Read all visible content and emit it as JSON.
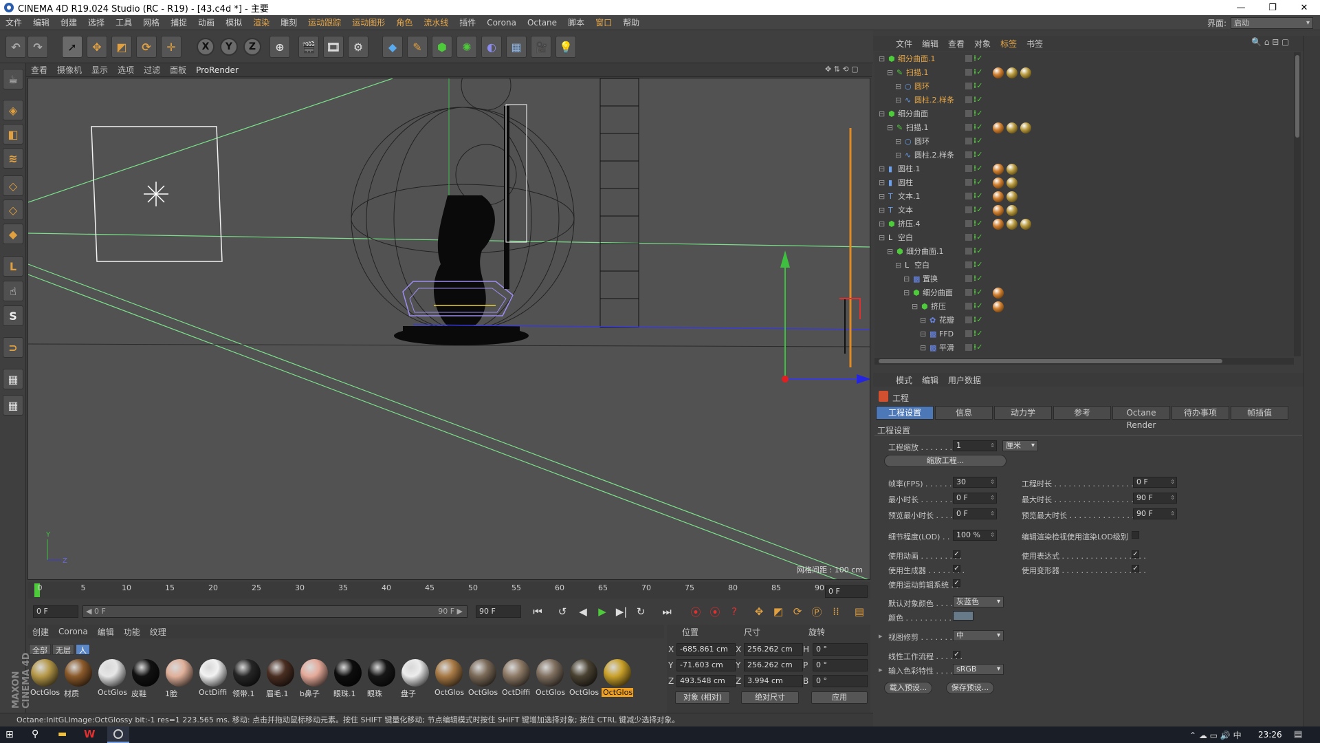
{
  "window": {
    "title": "CINEMA 4D R19.024 Studio (RC - R19) - [43.c4d *] - 主要",
    "minimize": "—",
    "maximize": "❐",
    "close": "✕"
  },
  "menu": {
    "items": [
      "文件",
      "编辑",
      "创建",
      "选择",
      "工具",
      "网格",
      "捕捉",
      "动画",
      "模拟",
      "渲染",
      "雕刻",
      "运动跟踪",
      "运动图形",
      "角色",
      "流水线",
      "插件",
      "Corona",
      "Octane",
      "脚本",
      "窗口",
      "帮助"
    ],
    "layout_label": "界面:",
    "layout_value": "启动"
  },
  "viewport": {
    "menu": [
      "查看",
      "摄像机",
      "显示",
      "选项",
      "过滤",
      "面板",
      "ProRender"
    ],
    "grid_label": "网格间距 : 100 cm",
    "axis_y": "Y",
    "axis_z": "Z"
  },
  "toolbar": {
    "x": "X",
    "y": "Y",
    "z": "Z"
  },
  "timeline": {
    "ticks": [
      "0",
      "5",
      "10",
      "15",
      "20",
      "25",
      "30",
      "35",
      "40",
      "45",
      "50",
      "55",
      "60",
      "65",
      "70",
      "75",
      "80",
      "85",
      "90"
    ],
    "current": "0 F",
    "start": "0 F",
    "range_start": "◀ 0 F",
    "range_end": "90 F ▶",
    "end": "90 F"
  },
  "material_manager": {
    "menu": [
      "创建",
      "Corona",
      "编辑",
      "功能",
      "纹理"
    ],
    "tabs": [
      "全部",
      "无层",
      "人"
    ],
    "materials": [
      {
        "name": "OctGlos",
        "color": "#b59848"
      },
      {
        "name": "材质",
        "color": "#8b5a2b"
      },
      {
        "name": "OctGlos",
        "color": "#e6e6e6"
      },
      {
        "name": "皮鞋",
        "color": "#111111"
      },
      {
        "name": "1脸",
        "color": "#e0b09a"
      },
      {
        "name": "OctDiffi",
        "color": "#f2f2f2"
      },
      {
        "name": "领带.1",
        "color": "#262626"
      },
      {
        "name": "眉毛.1",
        "color": "#4a2e22"
      },
      {
        "name": "b鼻子",
        "color": "#e5aa9a"
      },
      {
        "name": "眼珠.1",
        "color": "#0d0d0d"
      },
      {
        "name": "眼珠",
        "color": "#171717"
      },
      {
        "name": "盘子",
        "color": "#ececec"
      },
      {
        "name": "OctGlos",
        "color": "#a87a45"
      },
      {
        "name": "OctGlos",
        "color": "#7b6a58"
      },
      {
        "name": "OctDiffi",
        "color": "#8e7a66"
      },
      {
        "name": "OctGlos",
        "color": "#807060"
      },
      {
        "name": "OctGlos",
        "color": "#4a4232"
      },
      {
        "name": "OctGlos",
        "color": "#c9a12a"
      }
    ]
  },
  "coordinates": {
    "headers": [
      "位置",
      "尺寸",
      "旋转"
    ],
    "rows": [
      {
        "axis": "X",
        "pos": "-685.861 cm",
        "size_axis": "X",
        "size": "256.262 cm",
        "rot_axis": "H",
        "rot": "0 °"
      },
      {
        "axis": "Y",
        "pos": "-71.603 cm",
        "size_axis": "Y",
        "size": "256.262 cm",
        "rot_axis": "P",
        "rot": "0 °"
      },
      {
        "axis": "Z",
        "pos": "493.548 cm",
        "size_axis": "Z",
        "size": "3.994 cm",
        "rot_axis": "B",
        "rot": "0 °"
      }
    ],
    "mode": "对象 (相对)",
    "size_mode": "绝对尺寸",
    "apply": "应用"
  },
  "status": {
    "text": "Octane:InitGLImage:OctGlossy  bit:-1 res=1  223.565 ms.       移动: 点击并拖动鼠标移动元素。按住 SHIFT 键量化移动; 节点编辑模式时按住 SHIFT 键增加选择对象; 按住 CTRL 键减少选择对象。"
  },
  "object_manager": {
    "menu": [
      "文件",
      "编辑",
      "查看",
      "对象",
      "标签",
      "书签"
    ],
    "objects": [
      {
        "name": "细分曲面.1",
        "sel": true
      },
      {
        "name": "扫描.1",
        "sel": true
      },
      {
        "name": "圆环",
        "sel": true
      },
      {
        "name": "圆柱.2.样条",
        "sel": true
      },
      {
        "name": "细分曲面",
        "sel": false
      },
      {
        "name": "扫描.1",
        "sel": false
      },
      {
        "name": "圆环",
        "sel": false
      },
      {
        "name": "圆柱.2.样条",
        "sel": false
      },
      {
        "name": "圆柱.1",
        "sel": false
      },
      {
        "name": "圆柱",
        "sel": false
      },
      {
        "name": "文本.1",
        "sel": false
      },
      {
        "name": "文本",
        "sel": false
      },
      {
        "name": "挤压.4",
        "sel": false
      },
      {
        "name": "空白",
        "sel": false
      },
      {
        "name": "细分曲面.1",
        "sel": false
      },
      {
        "name": "空白",
        "sel": false
      },
      {
        "name": "置换",
        "sel": false
      },
      {
        "name": "细分曲面",
        "sel": false
      },
      {
        "name": "挤压",
        "sel": false
      },
      {
        "name": "花瓣",
        "sel": false
      },
      {
        "name": "FFD",
        "sel": false
      },
      {
        "name": "平滑",
        "sel": false
      }
    ]
  },
  "attributes": {
    "menu": [
      "模式",
      "编辑",
      "用户数据"
    ],
    "title": "工程",
    "tabs": [
      "工程设置",
      "信息",
      "动力学",
      "参考",
      "Octane Render",
      "待办事项",
      "帧插值"
    ],
    "section": "工程设置",
    "scale_label": "工程缩放 . . . . . . . . .",
    "scale_value": "1",
    "scale_unit": "厘米",
    "scale_button": "缩放工程...",
    "fps_label": "帧率(FPS) . . . . . . . .",
    "fps": "30",
    "project_time_label": "工程时长 . . . . . . . . . . . . . . . . . . . .",
    "project_time": "0 F",
    "min_time_label": "最小时长 . . . . . . . . .",
    "min_time": "0 F",
    "max_time_label": "最大时长 . . . . . . . . . . . . . . . . . . . .",
    "max_time": "90 F",
    "preview_min_label": "预览最小时长 . . . . . .",
    "preview_min": "0 F",
    "preview_max_label": "预览最大时长 . . . . . . . . . . . . . . . .",
    "preview_max": "90 F",
    "lod_label": "细节程度(LOD) . . . . .",
    "lod": "100 %",
    "lod_render_label": "编辑渲染检视使用渲染LOD级别",
    "use_anim": "使用动画 . . . . . . . . .",
    "use_expr": "使用表达式 . . . . . . . . . . . . . . . . . .",
    "use_gen": "使用生成器 . . . . . . . .",
    "use_deform": "使用变形器 . . . . . . . . . . . . . . . . . .",
    "use_motion": "使用运动剪辑系统 . .",
    "default_color_label": "默认对象颜色 . . . . . .",
    "default_color": "灰蓝色",
    "color_label": "颜色 . . . . . . . . . . . . .",
    "clip_label": "视图修剪 . . . . . . . . .",
    "clip": "中",
    "linear_label": "线性工作流程 . . . . . .",
    "input_color_label": "输入色彩特性 . . . . . .",
    "input_color": "sRGB",
    "load_preset": "载入预设...",
    "save_preset": "保存预设..."
  },
  "taskbar": {
    "time": "23:26"
  }
}
